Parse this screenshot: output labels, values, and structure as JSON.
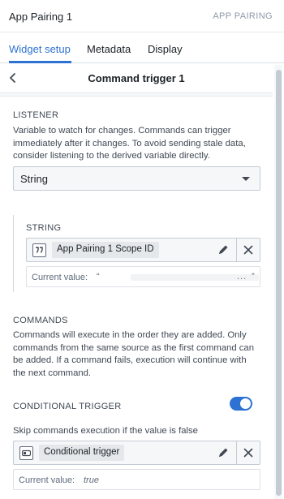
{
  "header": {
    "title": "App Pairing 1",
    "kind": "APP PAIRING"
  },
  "tabs": [
    {
      "label": "Widget setup",
      "active": true
    },
    {
      "label": "Metadata",
      "active": false
    },
    {
      "label": "Display",
      "active": false
    }
  ],
  "trigger": {
    "title": "Command trigger 1"
  },
  "listener": {
    "label": "LISTENER",
    "description": "Variable to watch for changes. Commands can trigger immediately after it changes. To avoid sending stale data, consider listening to the derived variable directly.",
    "type_select": "String"
  },
  "string": {
    "label": "STRING",
    "variable_chip": "App Pairing 1 Scope ID",
    "current_value_label": "Current value:",
    "open_quote": "“",
    "ellipsis": "...",
    "close_quote": "”"
  },
  "commands": {
    "label": "COMMANDS",
    "description": "Commands will execute in the order they are added. Only commands from the same source as the first command can be added. If a command fails, execution will continue with the next command."
  },
  "conditional": {
    "label": "CONDITIONAL TRIGGER",
    "enabled": true,
    "description": "Skip commands execution if the value is false",
    "variable_chip": "Conditional trigger",
    "current_value_label": "Current value:",
    "current_value": "true"
  },
  "colors": {
    "accent": "#2d72d2",
    "panel_bg": "#f6f7f9",
    "text": "#1c2127",
    "muted": "#5f6b7c"
  }
}
